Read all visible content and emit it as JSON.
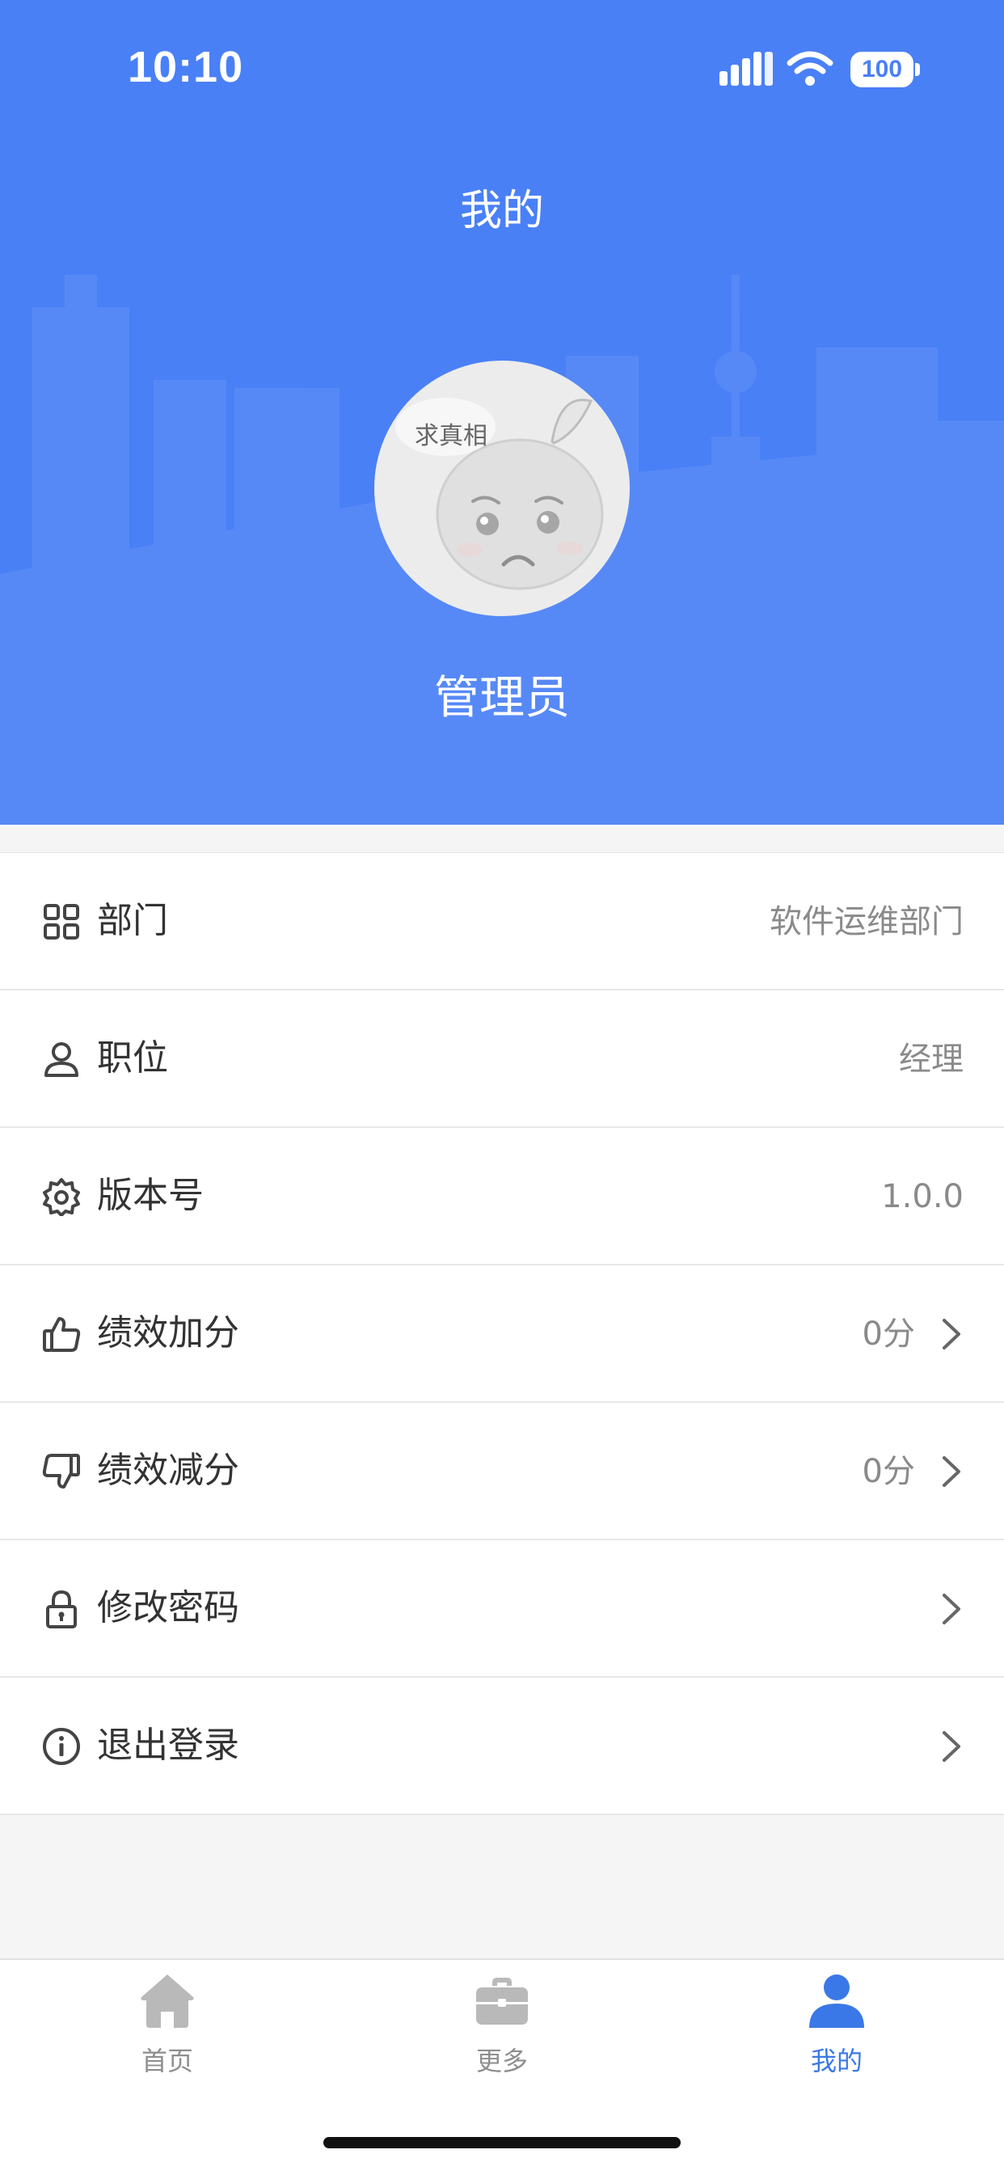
{
  "status_bar": {
    "time": "10:10",
    "battery": "100"
  },
  "header": {
    "title": "我的",
    "username": "管理员",
    "avatar_text": "求真相"
  },
  "profile_items": [
    {
      "icon": "grid-icon",
      "label": "部门",
      "value": "软件运维部门",
      "has_arrow": false
    },
    {
      "icon": "user-icon",
      "label": "职位",
      "value": "经理",
      "has_arrow": false
    },
    {
      "icon": "gear-icon",
      "label": "版本号",
      "value": "1.0.0",
      "has_arrow": false
    },
    {
      "icon": "thumbs-up-icon",
      "label": "绩效加分",
      "value": "0分",
      "has_arrow": true
    },
    {
      "icon": "thumbs-down-icon",
      "label": "绩效减分",
      "value": "0分",
      "has_arrow": true
    },
    {
      "icon": "lock-icon",
      "label": "修改密码",
      "value": "",
      "has_arrow": true
    },
    {
      "icon": "info-icon",
      "label": "退出登录",
      "value": "",
      "has_arrow": true
    }
  ],
  "tabbar": {
    "tabs": [
      {
        "label": "首页",
        "icon": "home-icon",
        "active": false
      },
      {
        "label": "更多",
        "icon": "briefcase-icon",
        "active": false
      },
      {
        "label": "我的",
        "icon": "person-icon",
        "active": true
      }
    ]
  },
  "colors": {
    "header_bg": "#4a80f6",
    "active_tab": "#3b78e7",
    "page_bg": "#f5f5f5"
  }
}
